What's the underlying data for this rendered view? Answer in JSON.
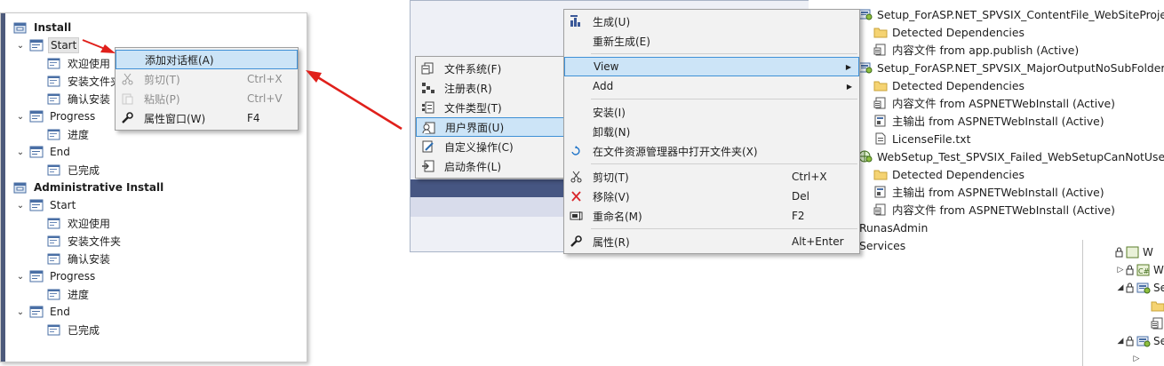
{
  "tree": {
    "sections": [
      {
        "title": "Install",
        "groups": [
          {
            "label": "Start",
            "items": [
              "欢迎使用",
              "安装文件夹",
              "确认安装"
            ]
          },
          {
            "label": "Progress",
            "items": [
              "进度"
            ]
          },
          {
            "label": "End",
            "items": [
              "已完成"
            ]
          }
        ]
      },
      {
        "title": "Administrative Install",
        "groups": [
          {
            "label": "Start",
            "items": [
              "欢迎使用",
              "安装文件夹",
              "确认安装"
            ]
          },
          {
            "label": "Progress",
            "items": [
              "进度"
            ]
          },
          {
            "label": "End",
            "items": [
              "已完成"
            ]
          }
        ]
      }
    ]
  },
  "tree_menu": {
    "items": [
      {
        "label": "添加对话框(A)",
        "shortcut": "",
        "icon": "",
        "state": "highlighted"
      },
      {
        "label": "剪切(T)",
        "shortcut": "Ctrl+X",
        "icon": "scissors-icon",
        "state": "disabled"
      },
      {
        "label": "粘贴(P)",
        "shortcut": "Ctrl+V",
        "icon": "paste-icon",
        "state": "disabled"
      },
      {
        "label": "属性窗口(W)",
        "shortcut": "F4",
        "icon": "wrench-icon",
        "state": "normal"
      }
    ]
  },
  "view_submenu": {
    "items": [
      {
        "label": "文件系统(F)",
        "icon": "file-system-icon"
      },
      {
        "label": "注册表(R)",
        "icon": "registry-icon"
      },
      {
        "label": "文件类型(T)",
        "icon": "file-types-icon"
      },
      {
        "label": "用户界面(U)",
        "icon": "user-interface-icon",
        "state": "highlighted"
      },
      {
        "label": "自定义操作(C)",
        "icon": "custom-actions-icon"
      },
      {
        "label": "启动条件(L)",
        "icon": "launch-conditions-icon"
      }
    ]
  },
  "project_menu": {
    "items": [
      {
        "label": "生成(U)",
        "shortcut": "",
        "icon": "build-icon"
      },
      {
        "label": "重新生成(E)",
        "shortcut": "",
        "icon": ""
      },
      {
        "sep": true
      },
      {
        "label": "View",
        "shortcut": "",
        "icon": "",
        "submenu": true,
        "state": "highlighted"
      },
      {
        "label": "Add",
        "shortcut": "",
        "icon": "",
        "submenu": true
      },
      {
        "sep": true
      },
      {
        "label": "安装(I)",
        "shortcut": "",
        "icon": ""
      },
      {
        "label": "卸载(N)",
        "shortcut": "",
        "icon": ""
      },
      {
        "label": "在文件资源管理器中打开文件夹(X)",
        "shortcut": "",
        "icon": "open-folder-icon"
      },
      {
        "sep": true
      },
      {
        "label": "剪切(T)",
        "shortcut": "Ctrl+X",
        "icon": "scissors-icon"
      },
      {
        "label": "移除(V)",
        "shortcut": "Del",
        "icon": "remove-icon"
      },
      {
        "label": "重命名(M)",
        "shortcut": "F2",
        "icon": "rename-icon"
      },
      {
        "sep": true
      },
      {
        "label": "属性(R)",
        "shortcut": "Alt+Enter",
        "icon": "wrench-icon"
      }
    ]
  },
  "solution_tree": {
    "rows": [
      {
        "label": "Setup_ForASP.NET_SPVSIX_ContentFile_WebSiteProjectO",
        "icon": "setup-project-icon",
        "level": 0
      },
      {
        "label": "Detected Dependencies",
        "icon": "folder-icon",
        "level": 1
      },
      {
        "label": "内容文件 from app.publish (Active)",
        "icon": "content-file-icon",
        "level": 1
      },
      {
        "label": "Setup_ForASP.NET_SPVSIX_MajorOutputNoSubFolder",
        "icon": "setup-project-icon",
        "level": 0
      },
      {
        "label": "Detected Dependencies",
        "icon": "folder-icon",
        "level": 1
      },
      {
        "label": "内容文件 from ASPNETWebInstall (Active)",
        "icon": "content-file-icon",
        "level": 1
      },
      {
        "label": "主输出 from ASPNETWebInstall (Active)",
        "icon": "primary-output-icon",
        "level": 1
      },
      {
        "label": "LicenseFile.txt",
        "icon": "text-file-icon",
        "level": 1
      },
      {
        "label": "WebSetup_Test_SPVSIX_Failed_WebSetupCanNotUse",
        "icon": "web-setup-icon",
        "level": 0
      },
      {
        "label": "Detected Dependencies",
        "icon": "folder-icon",
        "level": 1
      },
      {
        "label": "主输出 from ASPNETWebInstall (Active)",
        "icon": "primary-output-icon",
        "level": 1
      },
      {
        "label": "内容文件 from ASPNETWebInstall (Active)",
        "icon": "content-file-icon",
        "level": 1
      },
      {
        "label": "RunasAdmin",
        "icon": "",
        "level": -1
      },
      {
        "label": "Services",
        "icon": "",
        "level": -1
      }
    ]
  },
  "right_strip": {
    "rows": [
      {
        "label": "W",
        "icon": "web-project-icon",
        "twisty": ""
      },
      {
        "label": "W",
        "icon": "csharp-project-icon",
        "twisty": "▷"
      },
      {
        "label": "Se",
        "icon": "setup-project-icon",
        "twisty": "◢"
      },
      {
        "label": "",
        "icon": "folder-icon",
        "twisty": ""
      },
      {
        "label": "",
        "icon": "content-file-icon",
        "twisty": ""
      },
      {
        "label": "Se",
        "icon": "setup-project-icon",
        "twisty": "◢"
      },
      {
        "label": "",
        "icon": "",
        "twisty": "▷"
      }
    ]
  },
  "colors": {
    "menu_background": "#f2f2f2",
    "menu_highlight": "#cce4f7",
    "menu_highlight_border": "#3f90d6",
    "annotation_arrow": "#e0201b",
    "window_band": "#465682"
  }
}
